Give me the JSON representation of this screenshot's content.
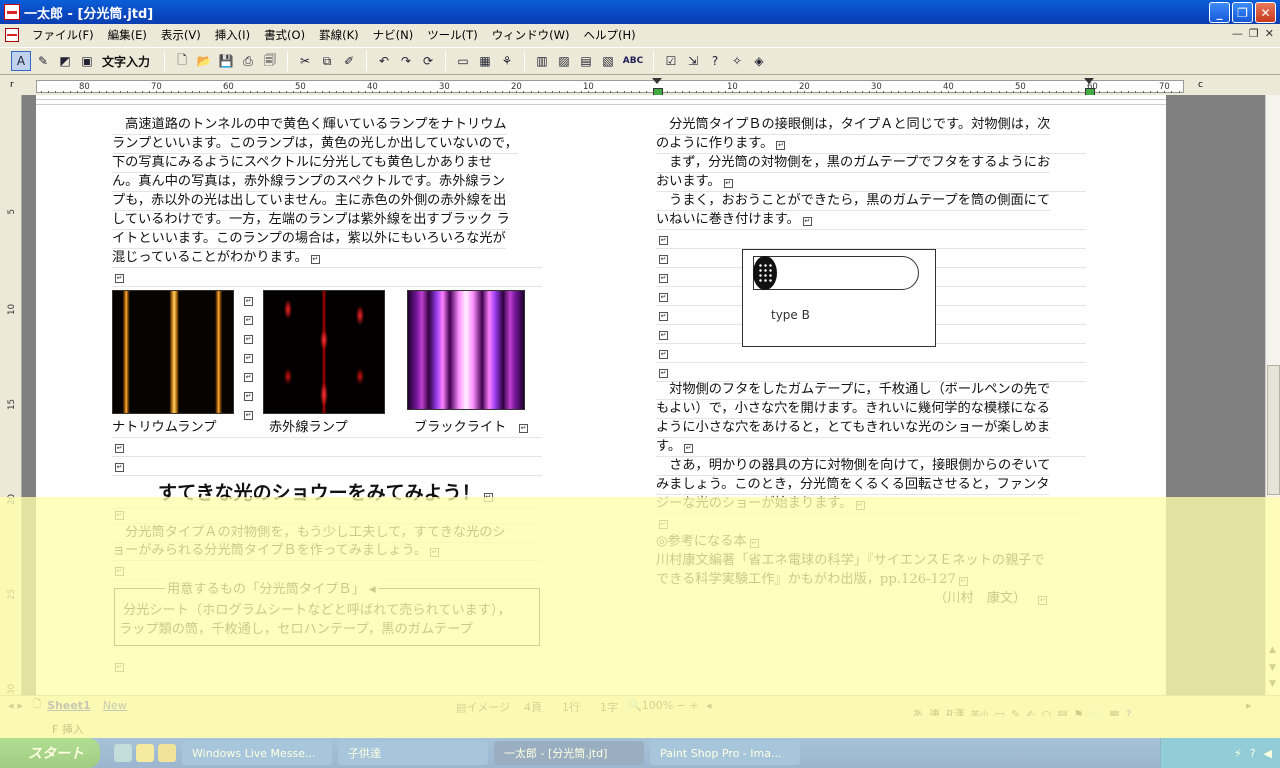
{
  "window": {
    "title": "一太郎 - [分光筒.jtd]"
  },
  "menu": [
    "ファイル(F)",
    "編集(E)",
    "表示(V)",
    "挿入(I)",
    "書式(O)",
    "罫線(K)",
    "ナビ(N)",
    "ツール(T)",
    "ウィンドウ(W)",
    "ヘルプ(H)"
  ],
  "toolbar": {
    "mode_label": "文字入力",
    "spell_label": "ABC"
  },
  "ruler": {
    "left_corner": "r",
    "right_corner": "c",
    "numbers": [
      "80",
      "70",
      "60",
      "50",
      "40",
      "30",
      "20",
      "10",
      "",
      "10",
      "20",
      "30",
      "40",
      "50",
      "60",
      "70"
    ]
  },
  "vruler_numbers": [
    "5",
    "10",
    "15",
    "20",
    "25",
    "30"
  ],
  "left_column": {
    "para1": [
      "　高速道路のトンネルの中で黄色く輝いているランプをナトリウム",
      "ランプといいます。このランプは，黄色の光しか出していないので，",
      "下の写真にみるようにスペクトルに分光しても黄色しかありませ",
      "ん。真ん中の写真は，赤外線ランプのスペクトルです。赤外線ラン",
      "プも，赤以外の光は出していません。主に赤色の外側の赤外線を出",
      "しているわけです。一方，左端のランプは紫外線を出すブラック ラ",
      "イトといいます。このランプの場合は，紫以外にもいろいろな光が",
      "混じっていることがわかります。"
    ],
    "captions": [
      "ナトリウムランプ",
      "赤外線ランプ",
      "ブラックライト"
    ],
    "heading": "すてきな光のショウーをみてみよう！",
    "para2": [
      "　分光筒タイプＡの対物側を，もう少し工夫して，すてきな光のシ",
      "ョーがみられる分光筒タイプＢを作ってみましょう。"
    ],
    "box_title": "用意するもの「分光筒タイプＢ」",
    "box_lines": [
      "分光シート（ホログラムシートなどと呼ばれて売られています），",
      "ラップ類の筒，千枚通し，セロハンテープ，黒のガムテープ"
    ]
  },
  "right_column": {
    "para1": [
      "　分光筒タイプＢの接眼側は，タイプＡと同じです。対物側は，次",
      "のように作ります。",
      "　まず，分光筒の対物側を，黒のガムテープでフタをするようにお",
      "おいます。",
      "　うまく，おおうことができたら，黒のガムテープを筒の側面にて",
      "いねいに巻き付けます。"
    ],
    "diagram_label": "type B",
    "para2": [
      "　対物側のフタをしたガムテープに，千枚通し（ボールペンの先で",
      "もよい）で，小さな穴を開けます。きれいに幾何学的な模様になる",
      "ように小さな穴をあけると，とてもきれいな光のショーが楽しめま",
      "す。",
      "　さあ，明かりの器具の方に対物側を向けて，接眼側からのぞいて",
      "みましょう。このとき，分光筒をくるくる回転させると，ファンタ",
      "ジーな光のショーが始まります。"
    ],
    "ref_title": "◎参考になる本",
    "ref_lines": [
      "川村康文編著「省エネ電球の科学」『サイエンスＥネットの親子で",
      "できる科学実験工作』かもがわ出版，pp.126-127"
    ],
    "author": "（川村　康文）"
  },
  "status": {
    "sheet_tab": "Sheet1",
    "new_tab": "New",
    "view": "イメージ",
    "page": "4頁",
    "line": "1行",
    "char": "1字",
    "zoom": "100%",
    "mode": "F 挿入",
    "ime": [
      "あ",
      "連",
      "R漢",
      "英小"
    ]
  },
  "taskbar": {
    "start": "スタート",
    "tasks": [
      "Windows Live Messe...",
      "子供達",
      "一太郎 - [分光筒.jtd]",
      "Paint Shop Pro - Ima..."
    ],
    "active_task": 2
  }
}
